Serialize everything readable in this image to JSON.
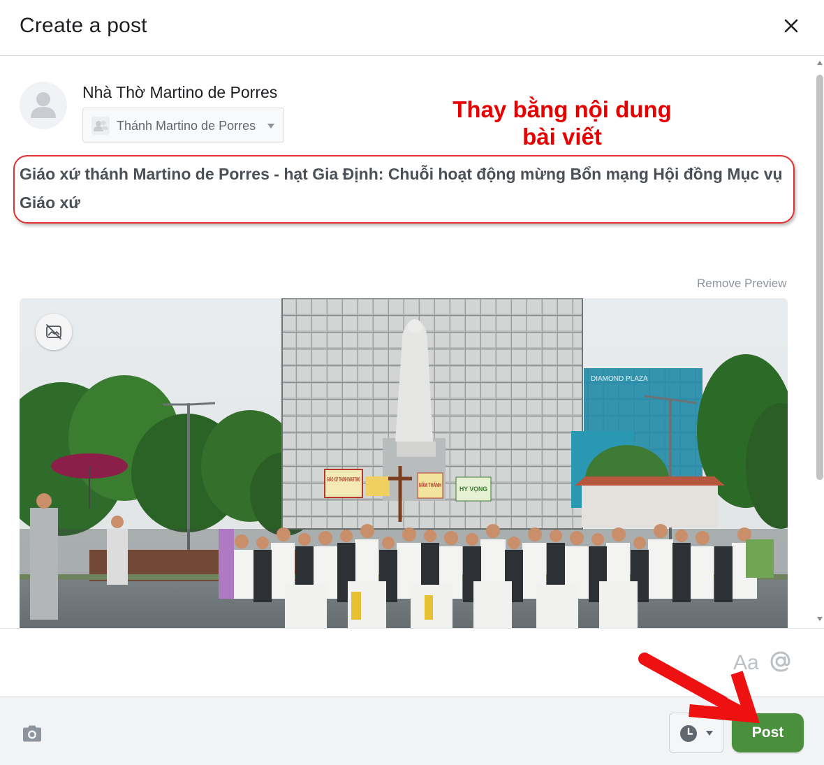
{
  "dialog": {
    "title": "Create a post",
    "close_icon": "close-icon"
  },
  "author": {
    "page_name": "Nhà Thờ Martino de Porres",
    "avatar_icon": "user-avatar-icon",
    "audience_label": "Thánh Martino de Porres",
    "audience_icon": "group-icon"
  },
  "annotation": {
    "line1": "Thay bằng nội dung",
    "line2": "bài viết",
    "color": "#e60000"
  },
  "post": {
    "text": "Giáo xứ thánh Martino de Porres - hạt Gia Định: Chuỗi hoạt động mừng Bổn mạng Hội đồng Mục vụ Giáo xứ"
  },
  "link_preview": {
    "remove_label": "Remove Preview",
    "hide_image_icon": "hide-image-icon",
    "image_sign_text": "DIAMOND PLAZA",
    "banner_1": "GIÁO XỨ THÁNH MARTINO",
    "banner_2": "NĂM THÁNH",
    "banner_3": "HY VỌNG"
  },
  "composer_tools": {
    "text_format_label": "Aa",
    "mention_icon": "at-sign-icon"
  },
  "footer": {
    "camera_icon": "camera-icon",
    "schedule_icon": "clock-icon",
    "post_label": "Post",
    "post_color": "#4a8f3c"
  }
}
